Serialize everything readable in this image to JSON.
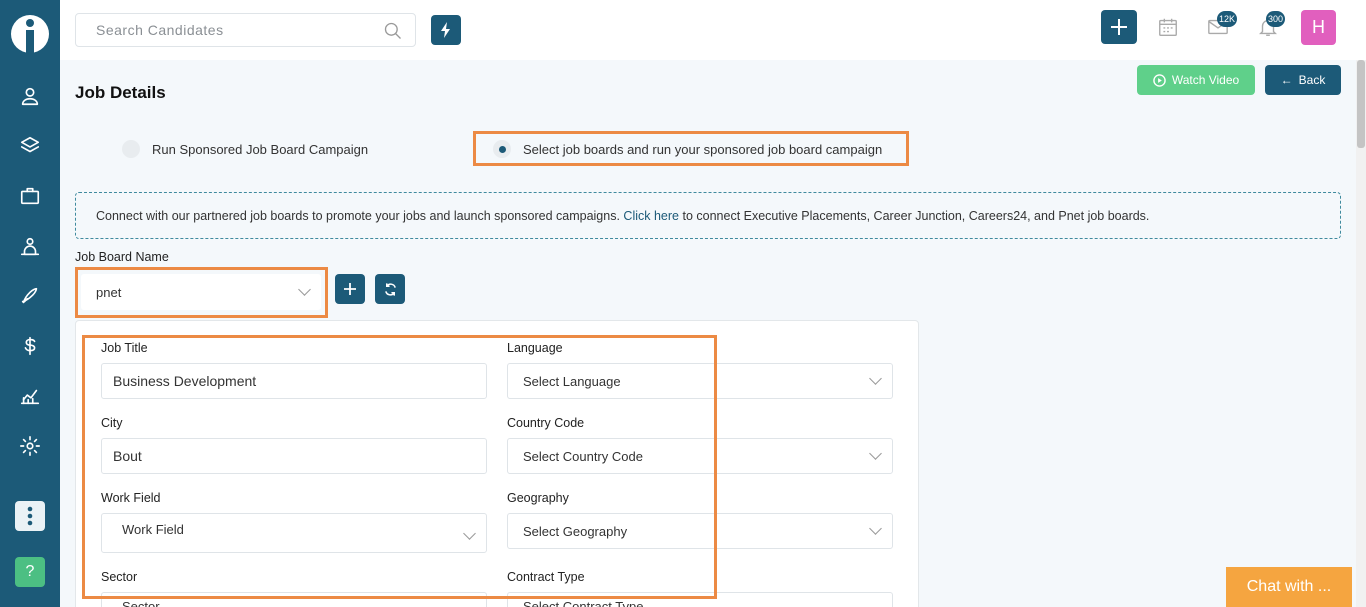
{
  "search": {
    "placeholder": "Search Candidates"
  },
  "topbar": {
    "mail_badge": "12K",
    "notif_badge": "300",
    "avatar_initial": "H"
  },
  "page": {
    "title": "Job Details",
    "watch_video": "Watch Video",
    "back": "Back"
  },
  "campaign": {
    "option1": "Run Sponsored Job Board Campaign",
    "option2": "Select job boards and run your sponsored job board campaign",
    "selected": "option2"
  },
  "info": {
    "text_before": "Connect with our partnered job boards to promote your jobs and launch sponsored campaigns.",
    "link": "Click here",
    "text_after": "to connect Executive Placements, Career Junction, Careers24, and Pnet job boards."
  },
  "job_board": {
    "label": "Job Board Name",
    "value": "pnet"
  },
  "form": {
    "job_title": {
      "label": "Job Title",
      "value": "Business Development"
    },
    "language": {
      "label": "Language",
      "placeholder": "Select Language"
    },
    "city": {
      "label": "City",
      "value": "Bout"
    },
    "country_code": {
      "label": "Country Code",
      "placeholder": "Select Country Code"
    },
    "work_field": {
      "label": "Work Field",
      "placeholder": "Work Field"
    },
    "geography": {
      "label": "Geography",
      "placeholder": "Select Geography"
    },
    "sector": {
      "label": "Sector",
      "placeholder": "Sector"
    },
    "contract_type": {
      "label": "Contract Type",
      "placeholder": "Select Contract Type"
    }
  },
  "chat": {
    "label": "Chat with ..."
  },
  "colors": {
    "primary": "#1c5a78",
    "accent_green": "#5fd08a",
    "highlight": "#ec8a44",
    "chat": "#f5a540",
    "avatar": "#e15fbe"
  }
}
